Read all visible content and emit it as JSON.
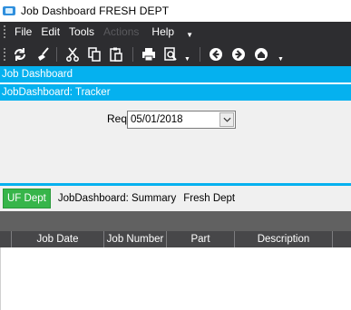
{
  "window": {
    "title": "Job Dashboard FRESH DEPT"
  },
  "menu": {
    "items": [
      {
        "label": "File",
        "enabled": true
      },
      {
        "label": "Edit",
        "enabled": true
      },
      {
        "label": "Tools",
        "enabled": true
      },
      {
        "label": "Actions",
        "enabled": false
      },
      {
        "label": "Help",
        "enabled": true
      }
    ]
  },
  "toolbar": {
    "icons": [
      "refresh-icon",
      "clear-icon",
      "cut-icon",
      "copy-icon",
      "paste-icon",
      "print-icon",
      "print-preview-icon",
      "back-icon",
      "forward-icon",
      "home-icon"
    ]
  },
  "panels": {
    "header": "Job Dashboard",
    "tracker": "JobDashboard: Tracker"
  },
  "form": {
    "req_by_label": "Req. By",
    "req_by_value": "05/01/2018"
  },
  "tabs": [
    {
      "label": "UF Dept",
      "active": true
    },
    {
      "label": "JobDashboard: Summary",
      "active": false
    },
    {
      "label": "Fresh Dept",
      "active": false
    }
  ],
  "grid": {
    "columns": [
      "Job Date",
      "Job Number",
      "Part",
      "Description"
    ],
    "rows": []
  },
  "colors": {
    "band_blue": "#05b1ef",
    "toolbar_dark": "#2d2d30",
    "active_tab_green": "#37b54a",
    "grid_header": "#474749"
  }
}
